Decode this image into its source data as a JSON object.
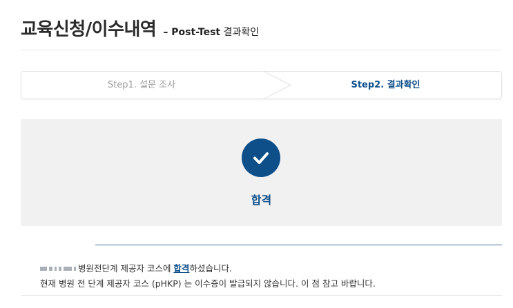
{
  "header": {
    "title": "교육신청/이수내역",
    "subtitle_prefix": "– Post-Test",
    "subtitle_suffix": "결과확인"
  },
  "stepper": {
    "steps": [
      {
        "label": "Step1. 설문 조사",
        "state": "done"
      },
      {
        "label": "Step2. 결과확인",
        "state": "active"
      }
    ]
  },
  "result": {
    "icon": "check-icon",
    "label": "합격"
  },
  "message": {
    "line1_before": "병원전단계 제공자 코스에 ",
    "line1_link": "합격",
    "line1_after": "하셨습니다.",
    "line2": "현재 병원 전 단계 제공자 코스 (pHKP) 는 이수증이 발급되지 않습니다. 이 점 참고 바랍니다."
  },
  "colors": {
    "accent": "#0e4f8a",
    "panel_background": "#f1f1f1",
    "inactive_step": "#9a9a9a"
  }
}
